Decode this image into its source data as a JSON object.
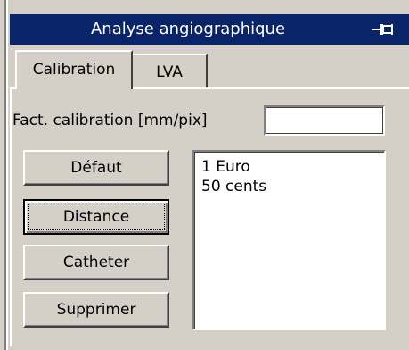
{
  "window": {
    "title": "Analyse angiographique",
    "pin_icon": "pin-icon"
  },
  "tabs": [
    {
      "label": "Calibration",
      "active": true
    },
    {
      "label": "LVA",
      "active": false
    }
  ],
  "calibration": {
    "factor_label": "Fact. calibration [mm/pix]",
    "factor_value": ""
  },
  "buttons": {
    "defaut": "Défaut",
    "distance": "Distance",
    "catheter": "Catheter",
    "supprimer": "Supprimer"
  },
  "list": {
    "items": [
      "1 Euro",
      "50 cents"
    ]
  },
  "colors": {
    "titlebar_bg": "#0a246a",
    "face": "#d4d0c8"
  }
}
